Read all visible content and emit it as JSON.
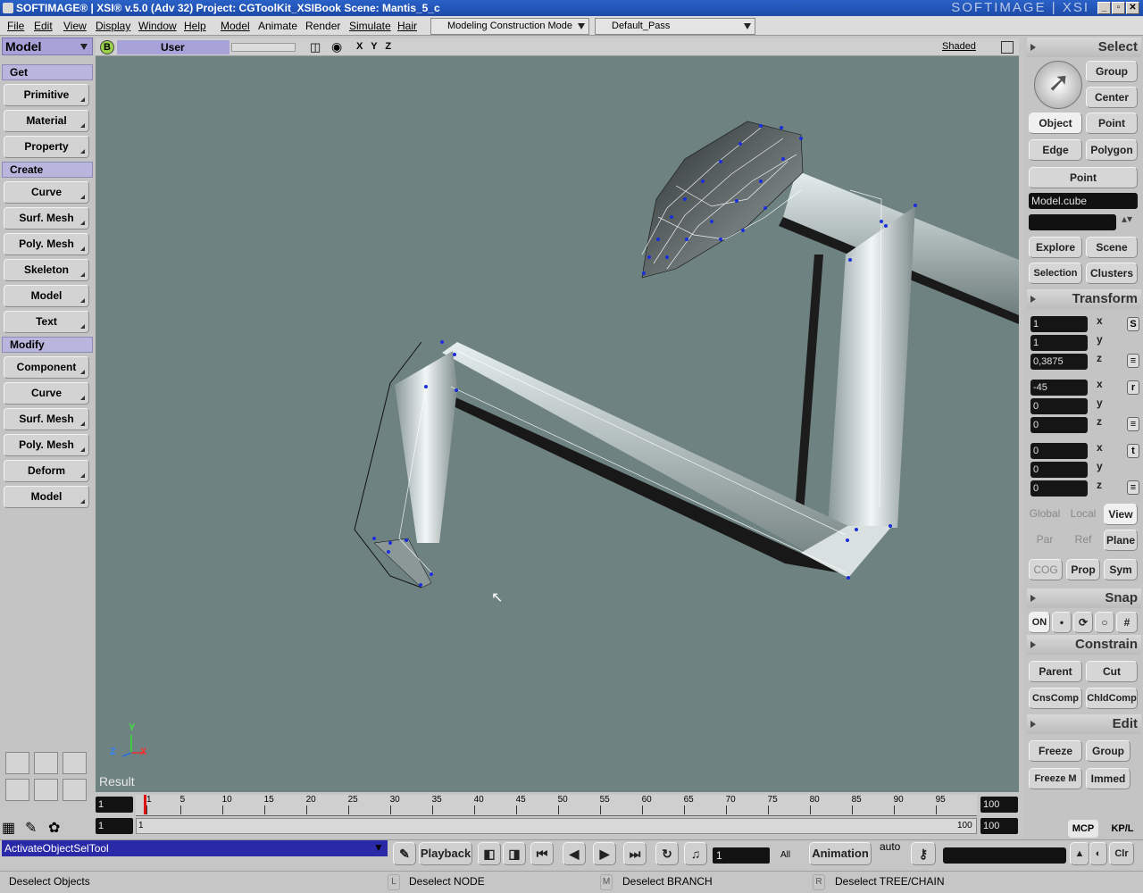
{
  "title": "SOFTIMAGE® | XSI® v.5.0 (Adv 32) Project: CGToolKit_XSIBook    Scene: Mantis_5_c",
  "brand": "SOFTIMAGE | XSI",
  "menus": [
    "File",
    "Edit",
    "View",
    "Display",
    "Window",
    "Help",
    "Model",
    "Animate",
    "Render",
    "Simulate",
    "Hair"
  ],
  "mode_combo": "Modeling Construction Mode",
  "pass_combo": "Default_Pass",
  "left": {
    "module": "Model",
    "sections": {
      "get": "Get",
      "create": "Create",
      "modify": "Modify"
    },
    "get": [
      "Primitive",
      "Material",
      "Property"
    ],
    "create": [
      "Curve",
      "Surf. Mesh",
      "Poly. Mesh",
      "Skeleton",
      "Model",
      "Text"
    ],
    "modify": [
      "Component",
      "Curve",
      "Surf. Mesh",
      "Poly. Mesh",
      "Deform",
      "Model"
    ]
  },
  "viewport": {
    "badge": "B",
    "camera": "User",
    "axes": "X Y Z",
    "display_mode": "Shaded",
    "result": "Result",
    "axis_labels": {
      "y": "Y",
      "x": "X",
      "z": "Z"
    }
  },
  "right": {
    "select_title": "Select",
    "group": "Group",
    "center": "Center",
    "object": "Object",
    "point": "Point",
    "edge": "Edge",
    "polygon": "Polygon",
    "point2": "Point",
    "selection_name": "Model.cube",
    "explore": "Explore",
    "scene": "Scene",
    "selection": "Selection",
    "clusters": "Clusters",
    "transform_title": "Transform",
    "scale": [
      "1",
      "1",
      "0,3875"
    ],
    "rotate": [
      "-45",
      "0",
      "0"
    ],
    "translate": [
      "0",
      "0",
      "0"
    ],
    "axes": [
      "x",
      "y",
      "z"
    ],
    "tool_s": "S",
    "tool_r": "r",
    "tool_t": "t",
    "global": "Global",
    "local": "Local",
    "view": "View",
    "par": "Par",
    "ref": "Ref",
    "plane": "Plane",
    "cog": "COG",
    "prop": "Prop",
    "sym": "Sym",
    "snap_title": "Snap",
    "snap_on": "ON",
    "constrain_title": "Constrain",
    "parent": "Parent",
    "cut": "Cut",
    "cnscomp": "CnsComp",
    "chldcomp": "ChldComp",
    "edit_title": "Edit",
    "freeze": "Freeze",
    "group2": "Group",
    "freezem": "Freeze M",
    "immed": "Immed"
  },
  "timeline": {
    "start": "1",
    "end_top": "100",
    "end_bottom": "100",
    "range_start": "1",
    "range_end": "100",
    "current_small": "1",
    "ticks": [
      "1",
      "5",
      "10",
      "15",
      "20",
      "25",
      "30",
      "35",
      "40",
      "45",
      "50",
      "55",
      "60",
      "65",
      "70",
      "75",
      "80",
      "85",
      "90",
      "95"
    ],
    "mcp": "MCP",
    "kpl": "KP/L"
  },
  "command": {
    "field": "ActivateObjectSelTool",
    "playback": "Playback",
    "frame": "1",
    "all": "All",
    "animation": "Animation",
    "auto": "auto",
    "clr": "Clr"
  },
  "status": {
    "main": "Deselect Objects",
    "l_key": "L",
    "l_text": "Deselect NODE",
    "m_key": "M",
    "m_text": "Deselect BRANCH",
    "r_key": "R",
    "r_text": "Deselect TREE/CHAIN"
  }
}
